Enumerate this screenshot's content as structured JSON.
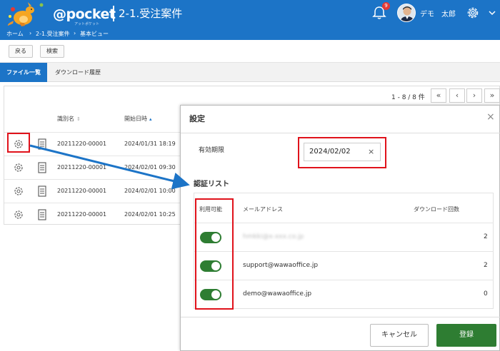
{
  "colors": {
    "brand": "#1c74c7",
    "accent_green": "#2e7d32",
    "highlight_red": "#e0121b"
  },
  "header": {
    "app_name": "@pocket",
    "app_subtitle": "アットポケット",
    "page_title": "2-1.受注案件",
    "notification_count": "9",
    "user_name": "デモ　太郎"
  },
  "breadcrumb": [
    "ホーム",
    "›",
    "2-1.受注案件",
    "›",
    "基本ビュー"
  ],
  "toolbar": {
    "back_label": "戻る",
    "search_label": "検索"
  },
  "tabs": [
    {
      "label": "ファイル一覧",
      "active": true
    },
    {
      "label": "ダウンロード履歴",
      "active": false
    }
  ],
  "list": {
    "pager_info": "1 - 8 / 8 件",
    "pager_buttons": [
      "«",
      "‹",
      "›",
      "»"
    ],
    "columns": [
      "識別名",
      "開始日時"
    ],
    "rows": [
      {
        "id": "20211220-00001",
        "start": "2024/01/31 18:19"
      },
      {
        "id": "20211220-00001",
        "start": "2024/02/01 09:30"
      },
      {
        "id": "20211220-00001",
        "start": "2024/02/01 10:00"
      },
      {
        "id": "20211220-00001",
        "start": "2024/02/01 10:25"
      }
    ]
  },
  "modal": {
    "title": "設定",
    "close_glyph": "×",
    "expiry_label": "有効期限",
    "expiry_value": "2024/02/02",
    "clear_glyph": "×",
    "auth_title": "認証リスト",
    "columns": {
      "enabled": "利用可能",
      "email": "メールアドレス",
      "downloads": "ダウンロード回数"
    },
    "entries": [
      {
        "enabled": true,
        "email": "hmkki@x-xxx.co.jp",
        "downloads": "2"
      },
      {
        "enabled": true,
        "email": "support@wawaoffice.jp",
        "downloads": "2"
      },
      {
        "enabled": true,
        "email": "demo@wawaoffice.jp",
        "downloads": "0"
      }
    ],
    "cancel_label": "キャンセル",
    "register_label": "登録"
  }
}
